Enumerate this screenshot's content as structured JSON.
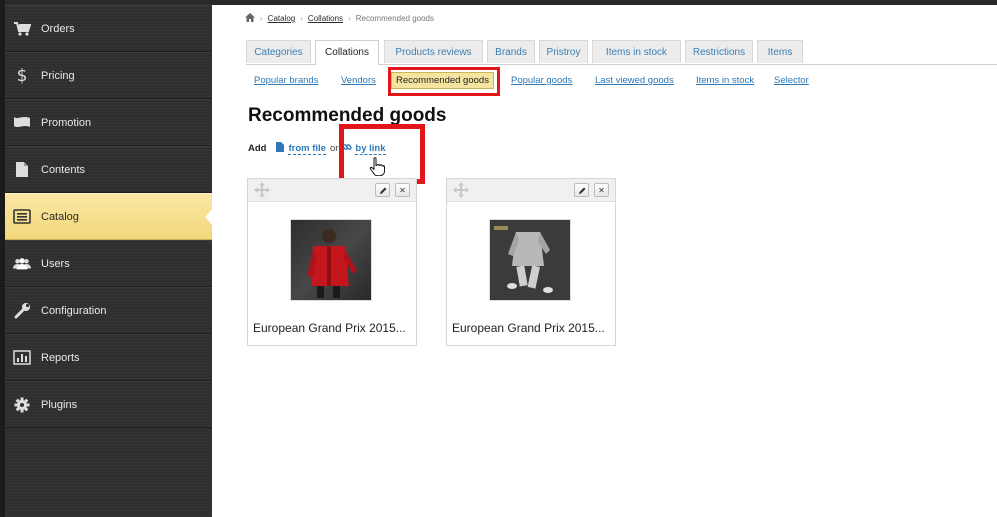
{
  "sidebar": {
    "items": [
      {
        "label": "Orders",
        "icon": "cart-icon"
      },
      {
        "label": "Pricing",
        "icon": "dollar-icon"
      },
      {
        "label": "Promotion",
        "icon": "flag-icon"
      },
      {
        "label": "Contents",
        "icon": "document-icon"
      },
      {
        "label": "Catalog",
        "icon": "list-icon",
        "active": true
      },
      {
        "label": "Users",
        "icon": "users-icon"
      },
      {
        "label": "Configuration",
        "icon": "wrench-icon"
      },
      {
        "label": "Reports",
        "icon": "chart-icon"
      },
      {
        "label": "Plugins",
        "icon": "gear-icon"
      }
    ]
  },
  "breadcrumb": {
    "home_icon": "home-icon",
    "items": [
      "Catalog",
      "Collations",
      "Recommended goods"
    ]
  },
  "tabs": [
    "Categories",
    "Collations",
    "Products reviews",
    "Brands",
    "Pristroy",
    "Items in stock",
    "Restrictions",
    "Items"
  ],
  "active_tab": "Collations",
  "subtabs": [
    "Popular brands",
    "Vendors",
    "Recommended goods",
    "Popular goods",
    "Last viewed goods",
    "Items in stock",
    "Selector"
  ],
  "active_subtab": "Recommended goods",
  "page_title": "Recommended goods",
  "add_row": {
    "label": "Add",
    "from_file": "from file",
    "or": "or",
    "by_link": "by link"
  },
  "cards": [
    {
      "name": "European Grand Prix 2015..."
    },
    {
      "name": "European Grand Prix 2015..."
    }
  ],
  "colors": {
    "highlight": "#e2151a",
    "active_item": "#f5e4a0",
    "link": "#2e78b6",
    "sidebar": "#2f2f2f"
  }
}
